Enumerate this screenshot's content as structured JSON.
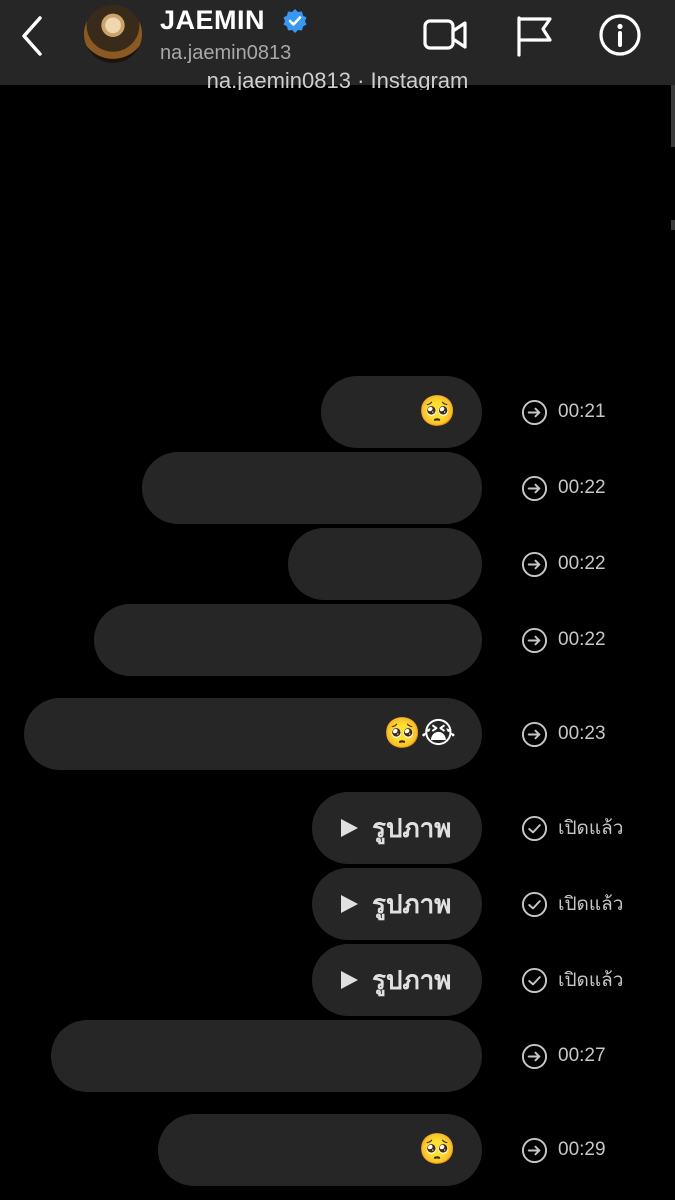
{
  "header": {
    "name": "JAEMIN",
    "handle": "na.jaemin0813",
    "icons": [
      "chevron-left-icon",
      "verified-badge-icon",
      "video-camera-icon",
      "flag-icon",
      "info-icon"
    ]
  },
  "cut_off_text": "na.jaemin0813 · Instagram",
  "messages": [
    {
      "emoji": "🥺",
      "status": "00:21",
      "status_icon": "arrow-right-circle-icon"
    },
    {
      "emoji": "",
      "status": "00:22",
      "status_icon": "arrow-right-circle-icon"
    },
    {
      "emoji": "",
      "status": "00:22",
      "status_icon": "arrow-right-circle-icon"
    },
    {
      "emoji": "",
      "status": "00:22",
      "status_icon": "arrow-right-circle-icon"
    },
    {
      "emoji": "🥺😭",
      "status": "00:23",
      "status_icon": "arrow-right-circle-icon"
    },
    {
      "media_label": "รูปภาพ",
      "status": "เปิดแล้ว",
      "status_icon": "check-circle-icon"
    },
    {
      "media_label": "รูปภาพ",
      "status": "เปิดแล้ว",
      "status_icon": "check-circle-icon"
    },
    {
      "media_label": "รูปภาพ",
      "status": "เปิดแล้ว",
      "status_icon": "check-circle-icon"
    },
    {
      "emoji": "",
      "status": "00:27",
      "status_icon": "arrow-right-circle-icon"
    },
    {
      "emoji": "🥺",
      "status": "00:29",
      "status_icon": "arrow-right-circle-icon"
    }
  ],
  "colors": {
    "background": "#000000",
    "header": "#262626",
    "bubble": "#262626",
    "verified": "#3897f0",
    "secondary_text": "#a8a8a8"
  }
}
